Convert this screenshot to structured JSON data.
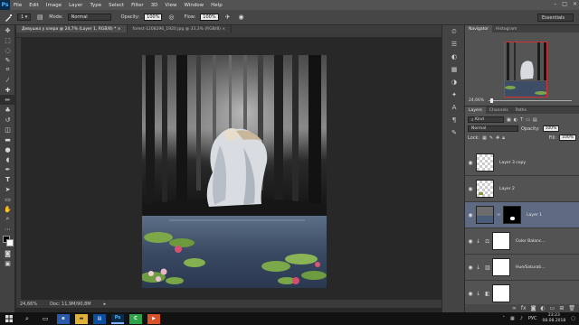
{
  "app": {
    "logo": "Ps"
  },
  "menu": [
    "File",
    "Edit",
    "Image",
    "Layer",
    "Type",
    "Select",
    "Filter",
    "3D",
    "View",
    "Window",
    "Help"
  ],
  "window_controls": [
    "–",
    "□",
    "×"
  ],
  "options": {
    "brush_size": "1",
    "mode_label": "Mode:",
    "mode_value": "Normal",
    "opacity_label": "Opacity:",
    "opacity_value": "100%",
    "flow_label": "Flow:",
    "flow_value": "100%",
    "workspace": "Essentials"
  },
  "tabs": [
    {
      "label": "Девушка у озера @ 24,7% (Layer 1, RGB/8) *",
      "active": true
    },
    {
      "label": "forest-1208296_1920.jpg @ 33,3% (RGB/8)",
      "active": false
    }
  ],
  "status": {
    "zoom": "24,66%",
    "doc": "Doc: 11,9M/90,8M"
  },
  "navigator": {
    "tabs": [
      "Navigator",
      "Histogram"
    ],
    "zoom": "24,66%"
  },
  "layers_panel": {
    "tabs": [
      "Layers",
      "Channels",
      "Paths"
    ],
    "kind_label": "Kind",
    "blend_mode": "Normal",
    "opacity_label": "Opacity:",
    "opacity_value": "100%",
    "lock_label": "Lock:",
    "fill_label": "Fill:",
    "fill_value": "100%",
    "layers": [
      {
        "name": "Layer 3 copy",
        "thumb": "checker",
        "selected": false
      },
      {
        "name": "Layer 2",
        "thumb": "checker-figure",
        "selected": false
      },
      {
        "name": "Layer 1",
        "thumb": "photo-mask",
        "selected": true
      },
      {
        "name": "Color Balanc...",
        "thumb": "adjustment",
        "selected": false
      },
      {
        "name": "Hue/Saturati...",
        "thumb": "adjustment",
        "selected": false
      },
      {
        "name": "",
        "thumb": "adjustment",
        "selected": false
      }
    ]
  },
  "taskbar": {
    "lang": "РУС",
    "time": "23:23",
    "date": "08.08.2018"
  }
}
